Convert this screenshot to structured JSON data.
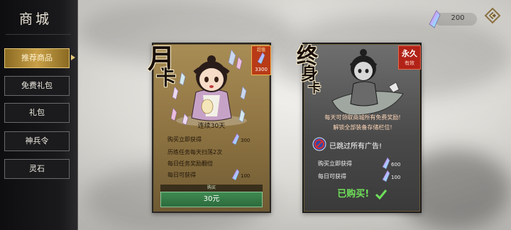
{
  "sidebar": {
    "title": "商城",
    "items": [
      {
        "label": "推荐商品",
        "active": true
      },
      {
        "label": "免费礼包",
        "active": false
      },
      {
        "label": "礼包",
        "active": false
      },
      {
        "label": "神兵令",
        "active": false
      },
      {
        "label": "灵石",
        "active": false
      }
    ]
  },
  "header": {
    "currency_value": "200",
    "currency_icon": "spirit-stone-icon",
    "close_icon": "back-diamond-icon"
  },
  "month_card": {
    "calligraphy_top": "月",
    "calligraphy_bottom": "卡",
    "price_tag_label": "超值",
    "price_tag_value": "3300",
    "duration": "连续30天",
    "rows": [
      {
        "text": "购买立即获得",
        "value": "300",
        "gem": true
      },
      {
        "text": "历练任务每天扫荡2次",
        "value": "",
        "gem": false
      },
      {
        "text": "每日任务奖励翻倍",
        "value": "",
        "gem": false
      },
      {
        "text": "每日可获得",
        "value": "100",
        "gem": true
      }
    ],
    "buy_label": "购买",
    "price": "30元"
  },
  "life_card": {
    "calligraphy_top": "终",
    "calligraphy_mid": "身",
    "calligraphy_bottom": "卡",
    "forever_title": "永久",
    "forever_sub": "有效",
    "desc_line1": "每天可领取商城所有免费奖励!",
    "desc_line2": "解锁全部装备存储栏位!",
    "ad_text": "已跳过所有广告!",
    "rows": [
      {
        "text": "购买立即获得",
        "value": "600"
      },
      {
        "text": "每日可获得",
        "value": "100"
      }
    ],
    "purchased": "已购买!"
  },
  "colors": {
    "accent_gold": "#c9a048",
    "buy_green": "#2c6b3c",
    "purchased_green": "#6fe05a",
    "tag_red": "#b83a16"
  }
}
